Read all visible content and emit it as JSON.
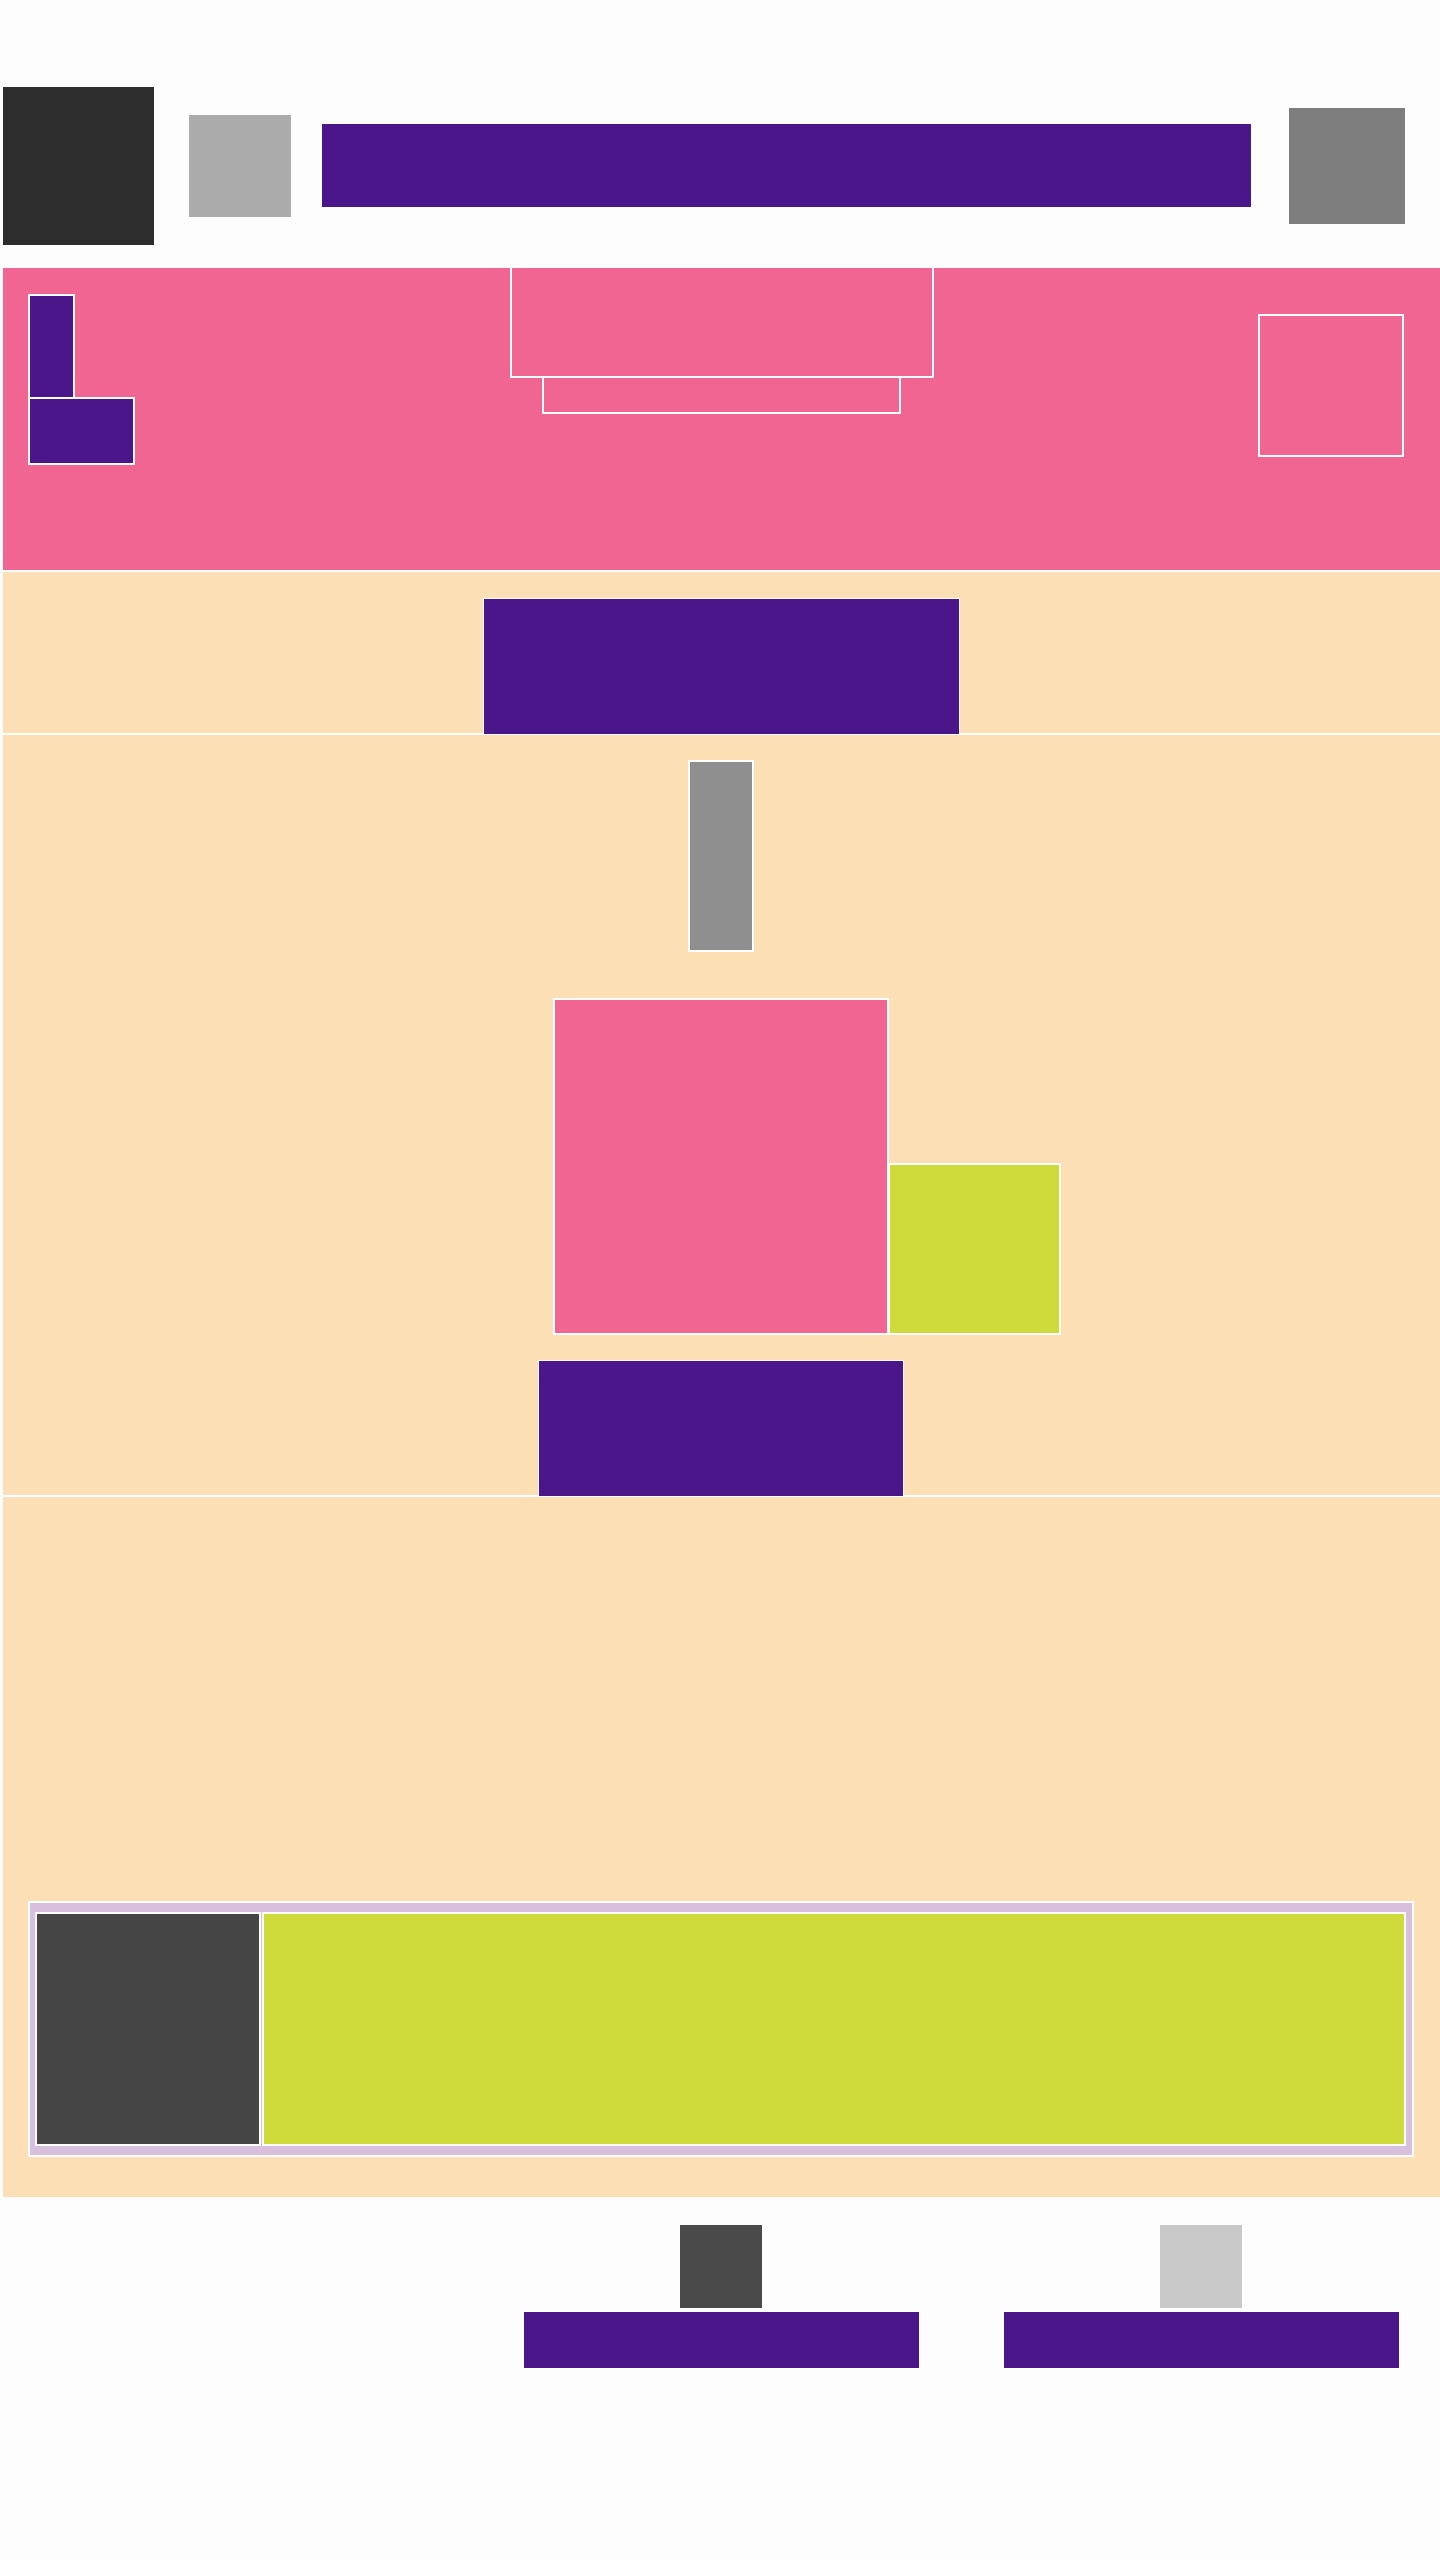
{
  "colors": {
    "page_background": "#fdfdfd",
    "primary": "#4b168a",
    "banner": "#f06591",
    "section": "#fcdfb4",
    "accent": "#cfdb3a",
    "dark": "#2d2d2d",
    "medium_dark": "#454545",
    "gray": "#7e7e7e",
    "gray_mid": "#8f8f8f",
    "gray_light": "#ababab",
    "gray_pale": "#c8c8c8",
    "frame": "#d8bfdd"
  },
  "header": {
    "search_value": "",
    "search_placeholder": ""
  },
  "banner": {
    "title": "",
    "subtitle": ""
  },
  "intro": {
    "cta_label": ""
  },
  "feature": {
    "cta_label": ""
  },
  "promo": {
    "description": ""
  },
  "bottom_nav": {
    "items": [
      {
        "label": "",
        "icon": "dark-square-icon"
      },
      {
        "label": "",
        "icon": "light-square-icon"
      }
    ]
  }
}
